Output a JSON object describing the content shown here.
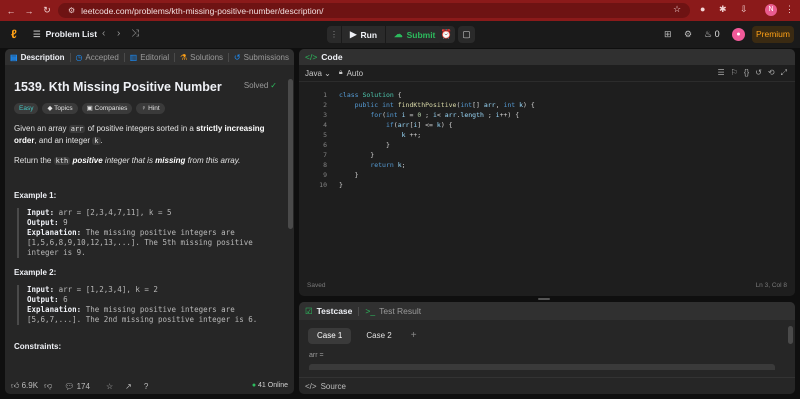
{
  "browser": {
    "url": "leetcode.com/problems/kth-missing-positive-number/description/",
    "profile_initial": "N"
  },
  "appbar": {
    "problem_list": "Problem List",
    "run": "Run",
    "submit": "Submit",
    "streak": "0",
    "premium": "Premium"
  },
  "left": {
    "tabs": [
      "Description",
      "Accepted",
      "Editorial",
      "Solutions",
      "Submissions"
    ],
    "title": "1539. Kth Missing Positive Number",
    "solved": "Solved",
    "chips": [
      "Easy",
      "Topics",
      "Companies",
      "Hint"
    ],
    "desc1a": "Given an array ",
    "desc1_code": "arr",
    "desc1b": " of positive integers sorted in a ",
    "desc1_bold": "strictly increasing order",
    "desc1c": ", and an integer ",
    "desc1_code2": "k",
    "desc1d": ".",
    "desc2a": "Return the ",
    "desc2_code": "kth",
    "desc2b": " positive",
    "desc2c": " integer that is ",
    "desc2_bold": "missing",
    "desc2d": " from this array.",
    "ex1_title": "Example 1:",
    "ex1_input_label": "Input:",
    "ex1_input": " arr = [2,3,4,7,11], k = 5",
    "ex1_output_label": "Output:",
    "ex1_output": " 9",
    "ex1_expl_label": "Explanation:",
    "ex1_expl": " The missing positive integers are [1,5,6,8,9,10,12,13,...]. The 5th missing positive integer is 9.",
    "ex2_title": "Example 2:",
    "ex2_input_label": "Input:",
    "ex2_input": " arr = [1,2,3,4], k = 2",
    "ex2_output_label": "Output:",
    "ex2_output": " 6",
    "ex2_expl_label": "Explanation:",
    "ex2_expl": " The missing positive integers are [5,6,7,...]. The 2nd missing positive integer is 6.",
    "constraints": "Constraints:",
    "likes": "6.9K",
    "comments": "174",
    "online": "41 Online"
  },
  "code": {
    "header": "Code",
    "language": "Java",
    "mode": "Auto",
    "line_numbers": [
      "1",
      "2",
      "3",
      "4",
      "5",
      "6",
      "7",
      "8",
      "9",
      "10"
    ],
    "saved": "Saved",
    "position": "Ln 3, Col 8"
  },
  "test": {
    "tab1": "Testcase",
    "tab2": "Test Result",
    "cases": [
      "Case 1",
      "Case 2"
    ],
    "add": "+",
    "arr_label": "arr =",
    "source": "Source"
  }
}
